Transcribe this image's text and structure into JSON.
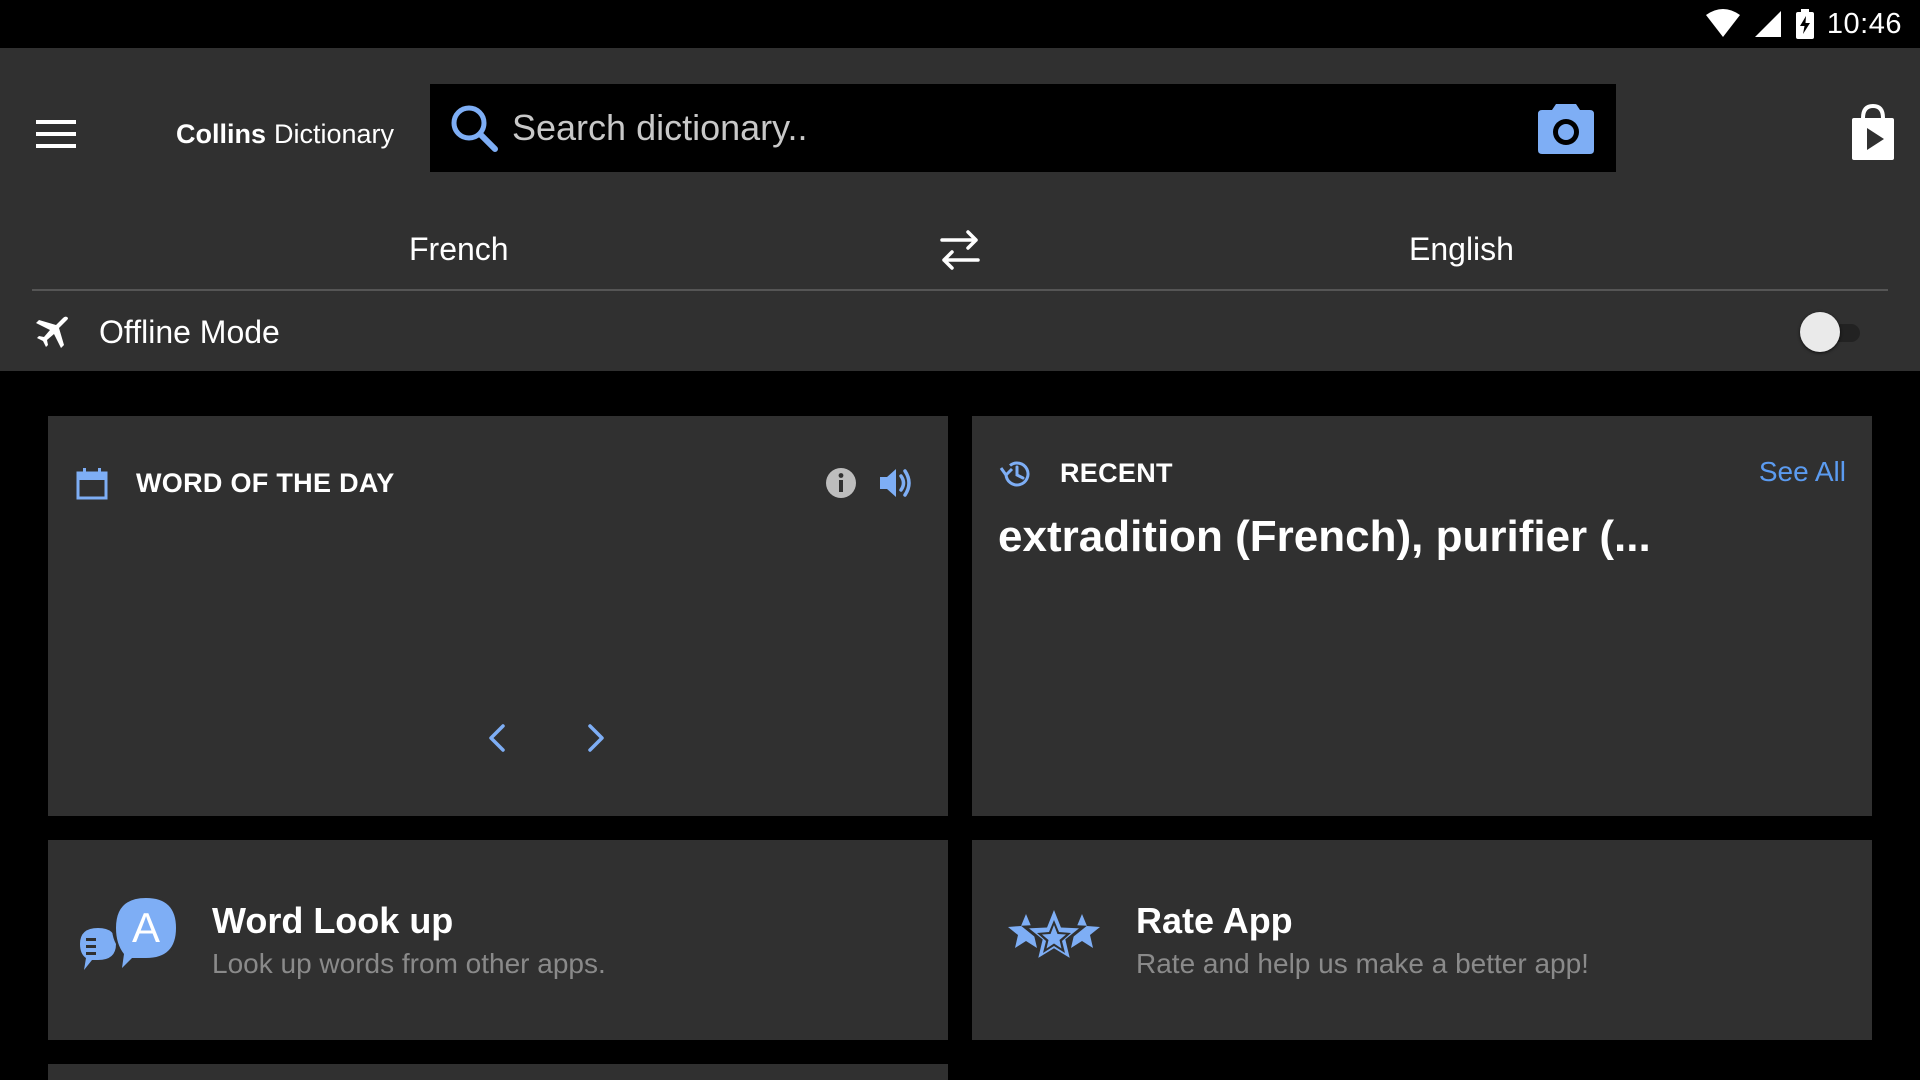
{
  "status_bar": {
    "time": "10:46"
  },
  "app_bar": {
    "title_brand": "Collins",
    "title_product": "Dictionary",
    "search": {
      "placeholder": "Search dictionary..",
      "value": ""
    },
    "languages": {
      "from": "French",
      "to": "English"
    },
    "offline": {
      "label": "Offline Mode",
      "enabled": false
    }
  },
  "word_of_the_day": {
    "title": "WORD OF THE DAY"
  },
  "recent": {
    "title": "RECENT",
    "see_all_label": "See All",
    "words": "extradition (French), purifier (..."
  },
  "word_lookup": {
    "title": "Word Look up",
    "subtitle": "Look up words from other apps."
  },
  "rate_app": {
    "title": "Rate App",
    "subtitle": "Rate and help us make a better app!"
  },
  "colors": {
    "accent": "#5b9bf0",
    "icon_blue": "#7eaef5",
    "surface": "#303030",
    "background": "#000000"
  },
  "icons": {
    "status": [
      "wifi-icon",
      "signal-icon",
      "battery-charging-icon"
    ],
    "app_bar": [
      "menu-icon",
      "search-icon",
      "camera-icon",
      "play-store-icon",
      "swap-icon",
      "airplane-icon"
    ],
    "cards": [
      "calendar-icon",
      "info-icon",
      "speaker-icon",
      "chevron-left-icon",
      "chevron-right-icon",
      "history-icon",
      "word-lookup-icon",
      "stars-icon"
    ]
  }
}
